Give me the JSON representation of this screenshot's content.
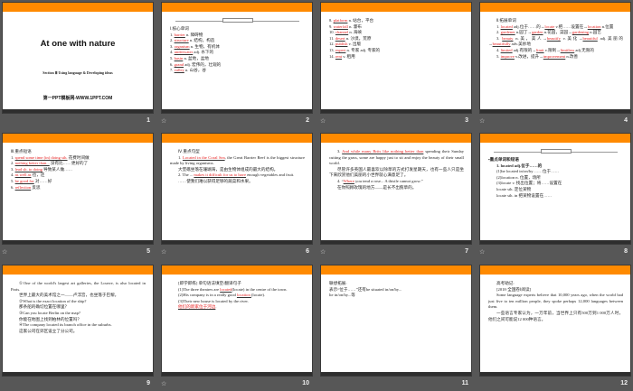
{
  "colors": {
    "accent": "#ff8a00",
    "answer": "#e82020"
  },
  "slides": [
    {
      "number": "1",
      "title": "At one with nature",
      "subtitle": "Section Ⅲ Using language & Developing ideas",
      "site": "第一PPT模板网-WWW.1PPT.COM"
    },
    {
      "number": "2",
      "anim": true,
      "header": true,
      "lines": [
        [
          {
            "t": "Ⅰ.核心单词"
          }
        ],
        [
          {
            "t": "1. "
          },
          {
            "t": "barrier",
            "r": 1
          },
          {
            "t": "  n.  障碍物"
          }
        ],
        [
          {
            "t": "2. "
          },
          {
            "t": "structure",
            "r": 1
          },
          {
            "t": " n.  结构，构造"
          }
        ],
        [
          {
            "t": "3. "
          },
          {
            "t": "organism",
            "r": 1
          },
          {
            "t": " n.  生物，有机体"
          }
        ],
        [
          {
            "t": "4. "
          },
          {
            "t": "underwater",
            "r": 1
          },
          {
            "t": " adj.  水下的"
          }
        ],
        [
          {
            "t": "5. "
          },
          {
            "t": "basin",
            "r": 1
          },
          {
            "t": "  n.  盆地，盆地"
          }
        ],
        [
          {
            "t": "6. "
          },
          {
            "t": "grand",
            "r": 1
          },
          {
            "t": "  adj.  宏伟的，壮观的"
          }
        ],
        [
          {
            "t": "7. "
          },
          {
            "t": "valley",
            "r": 1
          },
          {
            "t": "  n.  山谷，谷"
          }
        ]
      ]
    },
    {
      "number": "3",
      "anim": true,
      "lines": [
        [
          {
            "t": "8. "
          },
          {
            "t": "platform",
            "r": 1
          },
          {
            "t": "  n.  站台，平台"
          }
        ],
        [
          {
            "t": "9. "
          },
          {
            "t": "waterfall",
            "r": 1
          },
          {
            "t": "  n.  瀑布"
          }
        ],
        [
          {
            "t": "10. "
          },
          {
            "t": "channel",
            "r": 1
          },
          {
            "t": "  n.  海峡"
          }
        ],
        [
          {
            "t": "11. "
          },
          {
            "t": "desert",
            "r": 1
          },
          {
            "t": "  n.  沙漠，荒原"
          }
        ],
        [
          {
            "t": "12. "
          },
          {
            "t": "publish",
            "r": 1
          },
          {
            "t": "  v.  出版"
          }
        ],
        [
          {
            "t": "13. "
          },
          {
            "t": "expert",
            "r": 1
          },
          {
            "t": "  n.  专家 adj.  专家的"
          }
        ],
        [
          {
            "t": "14. "
          },
          {
            "t": "rent",
            "r": 1
          },
          {
            "t": "  v.  租用"
          }
        ]
      ]
    },
    {
      "number": "4",
      "anim": true,
      "lines": [
        [
          {
            "t": "Ⅱ.拓展单词",
            "i": 1
          }
        ],
        [
          {
            "t": "1. ",
            "i": 1
          },
          {
            "t": "located",
            "r": 1
          },
          {
            "t": " adj.位于……的→"
          },
          {
            "t": "locate",
            "r": 1
          },
          {
            "t": " v.把……设置在→"
          },
          {
            "t": "location",
            "r": 1
          },
          {
            "t": " n.位置"
          }
        ],
        [
          {
            "t": "2. ",
            "i": 1
          },
          {
            "t": "gardener",
            "r": 1
          },
          {
            "t": " n.园丁→"
          },
          {
            "t": "garden",
            "r": 1
          },
          {
            "t": " n.花园，菜园→"
          },
          {
            "t": "gardening",
            "r": 1
          },
          {
            "t": " n.园艺"
          }
        ],
        [
          {
            "t": "3. ",
            "i": 1
          },
          {
            "t": "beauty",
            "r": 1
          },
          {
            "t": " n.美，美人→"
          },
          {
            "t": "beautify",
            "r": 1
          },
          {
            "t": " v.美化→"
          },
          {
            "t": "beautiful",
            "r": 1
          },
          {
            "t": " adj.美丽的→"
          },
          {
            "t": "beautifully",
            "r": 1
          },
          {
            "t": " adv.美妙地"
          }
        ],
        [
          {
            "t": "4. ",
            "i": 1
          },
          {
            "t": "limited",
            "r": 1
          },
          {
            "t": " adj.有限的→"
          },
          {
            "t": "limit",
            "r": 1
          },
          {
            "t": " v.限制→"
          },
          {
            "t": "limitless",
            "r": 1
          },
          {
            "t": " adj.无限的"
          }
        ],
        [
          {
            "t": "5. ",
            "i": 1
          },
          {
            "t": "improve",
            "r": 1
          },
          {
            "t": " v.改进，提升→"
          },
          {
            "t": "improvement",
            "r": 1
          },
          {
            "t": " n.改善"
          }
        ]
      ]
    },
    {
      "number": "5",
      "anim": true,
      "lines": [
        [
          {
            "t": "Ⅲ.重点短语"
          }
        ],
        [
          {
            "t": "1. "
          },
          {
            "t": "spend some time (in) doing sth.",
            "r": 1
          },
          {
            "t": "   花费时间做"
          }
        ],
        [
          {
            "t": "2. "
          },
          {
            "t": "nothing better than...",
            "r": 1
          },
          {
            "t": "   没有比……更好的了"
          }
        ],
        [
          {
            "t": "3. "
          },
          {
            "t": "lead sb. to doing",
            "r": 1
          },
          {
            "t": "   导致某人做……"
          }
        ],
        [
          {
            "t": "4. "
          },
          {
            "t": "as well as",
            "r": 1
          },
          {
            "t": "   也，还"
          }
        ],
        [
          {
            "t": "5. "
          },
          {
            "t": "be good for",
            "r": 1
          },
          {
            "t": "   对……好"
          }
        ],
        [
          {
            "t": "6. "
          },
          {
            "t": "reflection",
            "r": 1
          },
          {
            "t": "   反思"
          }
        ]
      ]
    },
    {
      "number": "6",
      "anim": true,
      "lines": [
        [
          {
            "t": "Ⅳ.重点句型",
            "i": 1
          }
        ],
        [
          {
            "t": "1. ",
            "i": 1
          },
          {
            "t": "Located in the Coral Sea",
            "r": 1
          },
          {
            "t": ", the Great Barrier Reef is the biggest structure made by living organisms."
          }
        ],
        [
          {
            "t": "大堡礁坐落在珊瑚海，是由生物体组成的最大的结构。",
            "i": 1
          }
        ],
        [
          {
            "t": "2. The ... ",
            "i": 1
          },
          {
            "t": "makes it difficult for us to have",
            "r": 1
          },
          {
            "t": " enough vegetables and fruit."
          }
        ],
        [
          {
            "t": "……使我们难以获得足够的蔬菜和水果。",
            "i": 1
          }
        ]
      ]
    },
    {
      "number": "7",
      "anim": true,
      "lines": [
        [
          {
            "t": "3. ",
            "i": 1
          },
          {
            "t": "And while many Brits like nothing better than",
            "r": 1
          },
          {
            "t": " spending their Sunday cutting the grass, some are happy just to sit and enjoy the beauty of their small world."
          }
        ],
        [
          {
            "t": "尽管许多英国人最喜欢以除草的方式打发星期天，也有一些人只是坐下来欣赏他们美丽的小世界就心满意足了。",
            "i": 1
          }
        ],
        [
          {
            "t": "4. “",
            "i": 1
          },
          {
            "t": "Where",
            "r": 1
          },
          {
            "t": "  you tend a rose... A thistle cannot grow.”"
          }
        ],
        [
          {
            "t": "在你照顾玫瑰的地方——是长不出蓟草的。",
            "i": 1
          }
        ]
      ]
    },
    {
      "number": "8",
      "anim": true,
      "header": true,
      "lines": [
        [
          {
            "t": "▪重点单词和短语",
            "b": 1
          }
        ],
        [
          {
            "t": "1. located adj.位于……的",
            "b": 1,
            "i": 1
          }
        ],
        [
          {
            "t": " "
          }
        ],
        [
          {
            "t": "(1)be located in/on/by  ……位于……",
            "i": 1
          }
        ],
        [
          {
            "t": "(2)location n.  位置，场所",
            "i": 1
          }
        ],
        [
          {
            "t": "(3)locate v.  找出位置；将……设置在",
            "i": 1
          }
        ],
        [
          {
            "t": "locate sth.  定位某物",
            "i": 1
          }
        ],
        [
          {
            "t": "locate sth. in  把某物设置在……",
            "i": 1
          }
        ]
      ]
    },
    {
      "number": "9",
      "lines": [
        [
          {
            "t": "①One of the world's largest art galleries, the Louvre, is also located in Paris.",
            "i": 1
          }
        ],
        [
          {
            "t": "世界上最大的美术馆之一——卢浮宫，也坐落于巴黎。",
            "i": 1
          }
        ],
        [
          {
            "t": "②What is the exact location of the ship?",
            "i": 1
          }
        ],
        [
          {
            "t": "那条船的确切位置在哪里？",
            "i": 1
          }
        ],
        [
          {
            "t": "③Can you locate Berlin on the map?",
            "i": 1
          }
        ],
        [
          {
            "t": "你能在地图上找到柏林的位置吗？",
            "i": 1
          }
        ],
        [
          {
            "t": "④The company located its branch office in the suburbs.",
            "i": 1
          }
        ],
        [
          {
            "t": "这家公司在郊区设立了分公司。",
            "i": 1
          }
        ]
      ]
    },
    {
      "number": "10",
      "anim": true,
      "lines": [
        [
          {
            "t": "[即学即练]  单句语法填空/翻译句子",
            "i": 1
          }
        ],
        [
          {
            "t": "(1)The three theatres are ",
            "i": 1
          },
          {
            "t": "located",
            "r": 1
          },
          {
            "t": "(locate) in the centre of the town."
          }
        ],
        [
          {
            "t": "(2)His company is in a really good ",
            "i": 1
          },
          {
            "t": "  location  ",
            "r": 1
          },
          {
            "t": " (locate)."
          }
        ],
        [
          {
            "t": "(3)Their new house is located by the river.",
            "i": 1
          }
        ],
        [
          {
            "t": " ",
            "i": 1
          },
          {
            "t": "他们的新家位于河边",
            "r": 1
          },
          {
            "t": "."
          }
        ]
      ]
    },
    {
      "number": "11",
      "lines": [
        [
          {
            "t": "联想拓展:"
          }
        ],
        [
          {
            "t": "表示“位于……”还有be situated in/on/by..."
          }
        ],
        [
          {
            "t": "lie in/on/by...等"
          }
        ]
      ]
    },
    {
      "number": "12",
      "lines": [
        [
          {
            "t": "高考助记:",
            "i": 1
          }
        ],
        [
          {
            "t": "[2018·全国卷Ⅰ阅读]",
            "i": 1
          }
        ],
        [
          {
            "t": "Some language experts believe that 10,000 years ago, when the world had just five to ten million people, they spoke perhaps 12,000 languages between them.",
            "i": 1
          }
        ],
        [
          {
            "t": "一些语言专家认为，一万年前，当世界上只有500万到1 000万人时，他们之间可能说12 000种语言。",
            "i": 1
          }
        ]
      ]
    }
  ]
}
